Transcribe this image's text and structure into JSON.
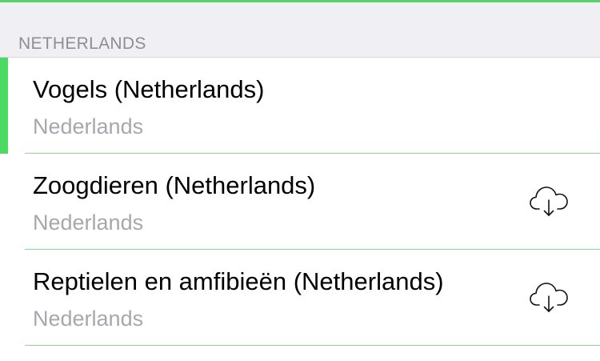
{
  "section": {
    "title": "NETHERLANDS"
  },
  "rows": [
    {
      "title": "Vogels (Netherlands)",
      "subtitle": "Nederlands",
      "selected": true,
      "downloadable": false
    },
    {
      "title": "Zoogdieren (Netherlands)",
      "subtitle": "Nederlands",
      "selected": false,
      "downloadable": true,
      "icon": "cloud-download-icon"
    },
    {
      "title": "Reptielen en amfibieën (Netherlands)",
      "subtitle": "Nederlands",
      "selected": false,
      "downloadable": true,
      "icon": "cloud-download-icon"
    }
  ],
  "colors": {
    "accent": "#4cd964",
    "separator": "#8fd998",
    "header_background": "#efeff4",
    "secondary_text": "#a7a7ad"
  }
}
